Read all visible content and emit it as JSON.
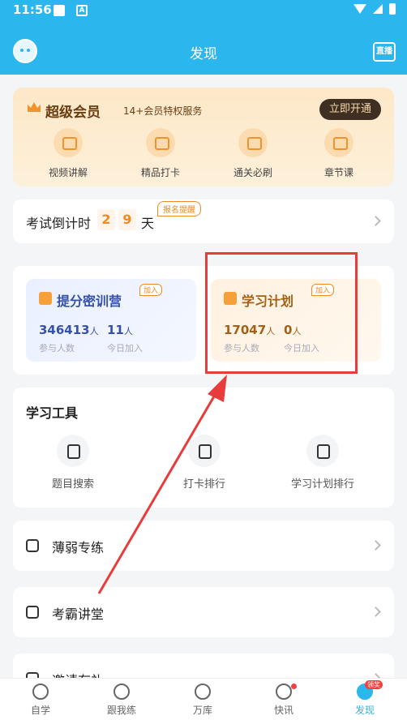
{
  "status_bar": {
    "time": "11:56"
  },
  "header": {
    "title": "发现",
    "live_label": "直播"
  },
  "vip": {
    "name": "超级会员",
    "desc": "14+会员特权服务",
    "open_label": "立即开通",
    "features": [
      "视频讲解",
      "精品打卡",
      "通关必刷",
      "章节课"
    ]
  },
  "countdown": {
    "label": "考试倒计时",
    "digits": [
      "2",
      "9"
    ],
    "unit": "天",
    "tag": "报名提醒"
  },
  "camps": [
    {
      "title": "提分密训营",
      "join": "加入",
      "participants": "346413",
      "participants_unit": "人",
      "participants_label": "参与人数",
      "today": "11",
      "today_unit": "人",
      "today_label": "今日加入"
    },
    {
      "title": "学习计划",
      "join": "加入",
      "participants": "17047",
      "participants_unit": "人",
      "participants_label": "参与人数",
      "today": "0",
      "today_unit": "人",
      "today_label": "今日加入"
    }
  ],
  "tools": {
    "heading": "学习工具",
    "items": [
      "题目搜索",
      "打卡排行",
      "学习计划排行"
    ]
  },
  "menu": [
    "薄弱专练",
    "考霸讲堂",
    "邀请有礼"
  ],
  "tabbar": {
    "items": [
      "自学",
      "跟我练",
      "万库",
      "快讯",
      "发现"
    ],
    "badge": "领奖"
  },
  "colors": {
    "primary": "#2bb6ee",
    "annotation": "#e83c3c",
    "accent": "#f08a24"
  }
}
